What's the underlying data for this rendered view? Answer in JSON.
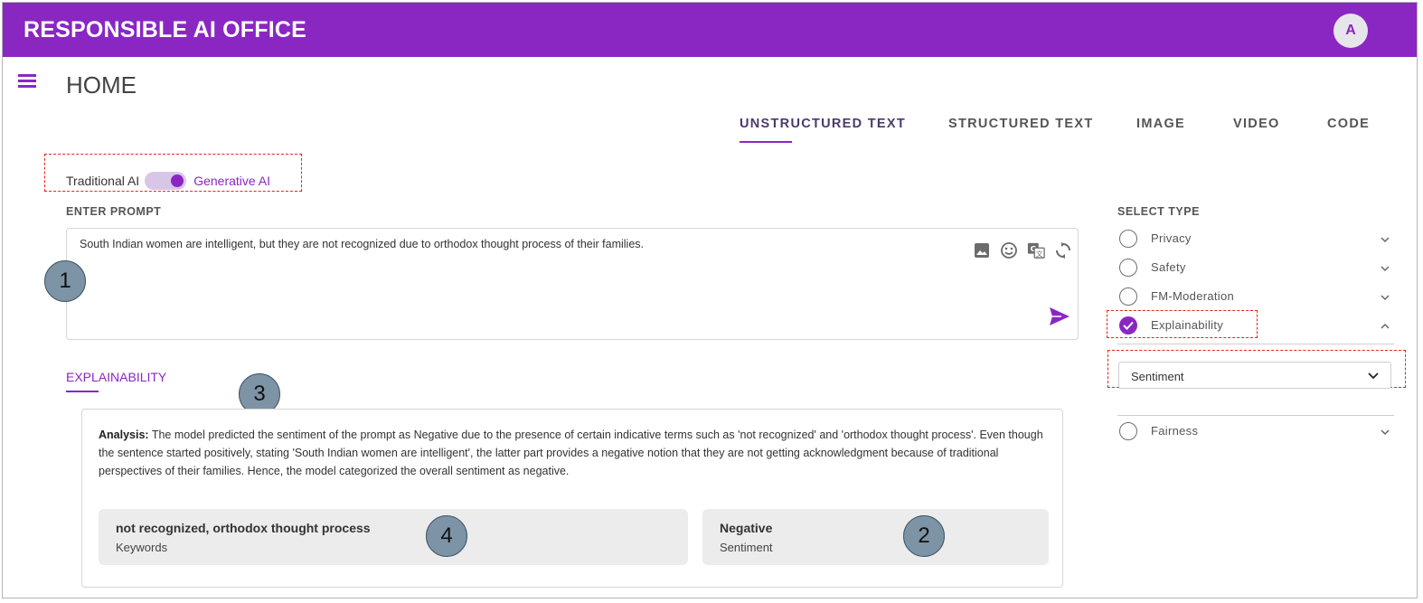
{
  "app": {
    "title": "RESPONSIBLE AI OFFICE",
    "avatar_initial": "A"
  },
  "page": {
    "title": "HOME"
  },
  "tabs": [
    {
      "label": "UNSTRUCTURED TEXT",
      "active": true
    },
    {
      "label": "STRUCTURED TEXT",
      "active": false
    },
    {
      "label": "IMAGE",
      "active": false
    },
    {
      "label": "VIDEO",
      "active": false
    },
    {
      "label": "CODE",
      "active": false
    }
  ],
  "mode_toggle": {
    "left_label": "Traditional AI",
    "right_label": "Generative AI",
    "selected": "Generative AI"
  },
  "prompt": {
    "label": "ENTER PROMPT",
    "value": "South Indian women are intelligent, but they are not recognized due to orthodox thought process of their families.",
    "icons": [
      "image-icon",
      "emoji-icon",
      "translate-icon",
      "refresh-icon",
      "send-icon"
    ]
  },
  "annotations": [
    "1",
    "2",
    "3",
    "4"
  ],
  "explainability": {
    "tab_label": "EXPLAINABILITY",
    "analysis_label": "Analysis:",
    "analysis_text": " The model predicted the sentiment of the prompt as Negative due to the presence of certain indicative terms such as 'not recognized' and 'orthodox thought process'. Even though the sentence started positively, stating 'South Indian women are intelligent', the latter part provides a negative notion that they are not getting acknowledgment because of traditional perspectives of their families. Hence, the model categorized the overall sentiment as negative.",
    "keywords": {
      "value": "not recognized, orthodox thought process",
      "label": "Keywords"
    },
    "sentiment": {
      "value": "Negative",
      "label": "Sentiment"
    }
  },
  "select_type": {
    "label": "SELECT TYPE",
    "items": [
      {
        "label": "Privacy",
        "checked": false,
        "expanded": false
      },
      {
        "label": "Safety",
        "checked": false,
        "expanded": false
      },
      {
        "label": "FM-Moderation",
        "checked": false,
        "expanded": false
      },
      {
        "label": "Explainability",
        "checked": true,
        "expanded": true
      },
      {
        "label": "Fairness",
        "checked": false,
        "expanded": false
      }
    ],
    "explainability_dropdown": {
      "selected": "Sentiment"
    }
  },
  "colors": {
    "brand": "#8a27c3",
    "highlight": "#e8231f",
    "chip_bg": "#ececec",
    "badge": "#7d93a6"
  }
}
